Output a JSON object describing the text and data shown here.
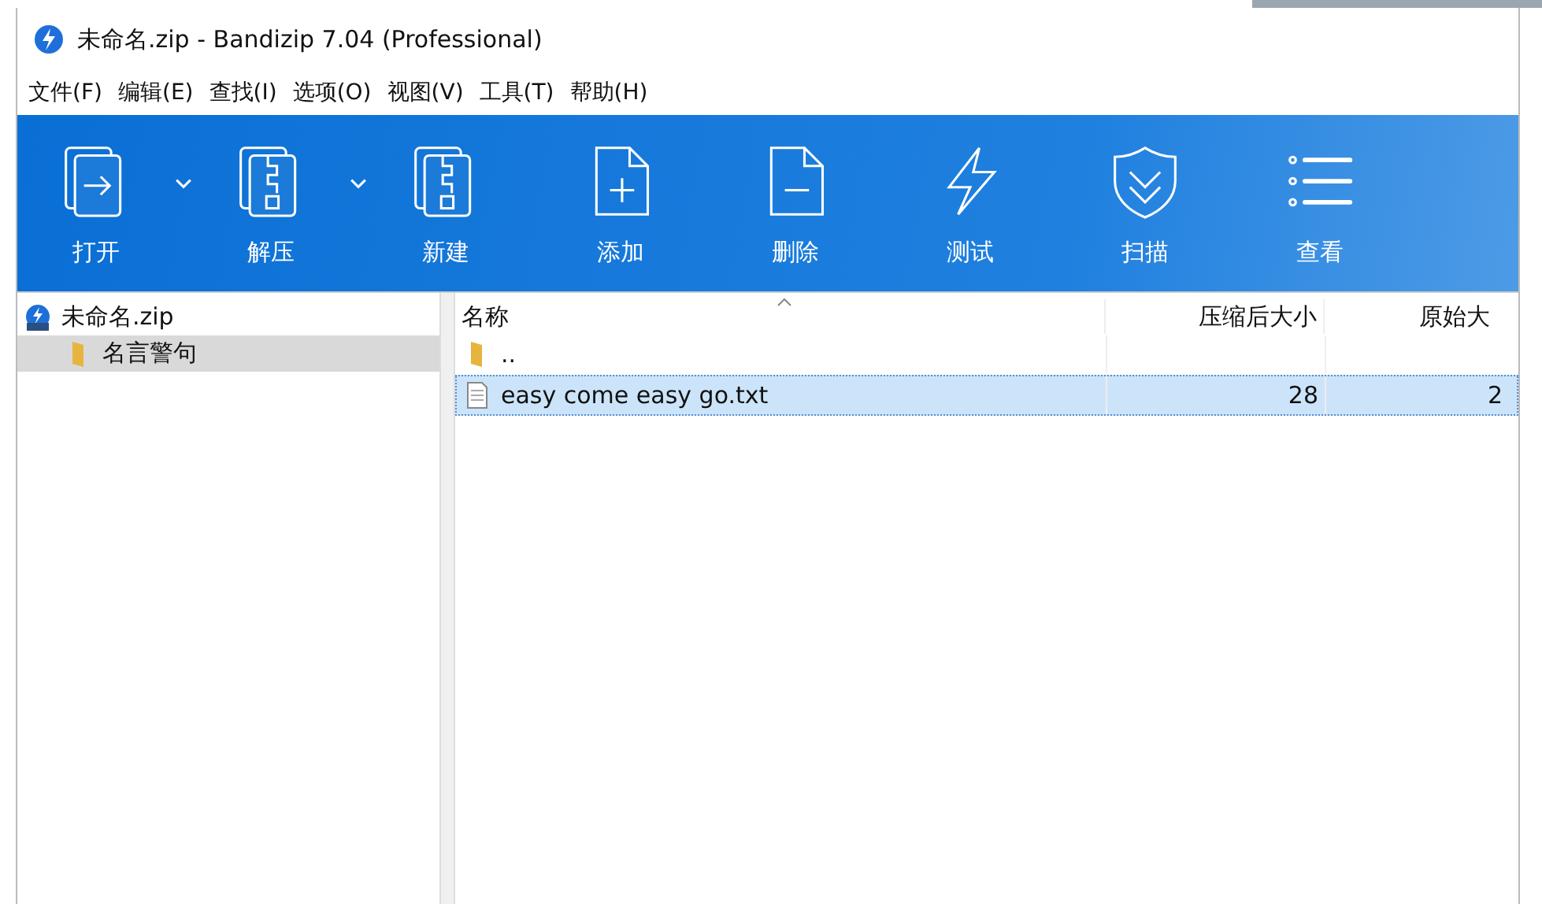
{
  "window": {
    "title": "未命名.zip - Bandizip 7.04 (Professional)"
  },
  "menu": [
    "文件(F)",
    "编辑(E)",
    "查找(I)",
    "选项(O)",
    "视图(V)",
    "工具(T)",
    "帮助(H)"
  ],
  "toolbar": [
    {
      "label": "打开",
      "kind": "open",
      "dropdown": true
    },
    {
      "label": "解压",
      "kind": "extract",
      "dropdown": true
    },
    {
      "label": "新建",
      "kind": "new",
      "dropdown": false
    },
    {
      "label": "添加",
      "kind": "add",
      "dropdown": false
    },
    {
      "label": "删除",
      "kind": "delete",
      "dropdown": false
    },
    {
      "label": "测试",
      "kind": "test",
      "dropdown": false
    },
    {
      "label": "扫描",
      "kind": "scan",
      "dropdown": false
    },
    {
      "label": "查看",
      "kind": "view",
      "dropdown": false
    }
  ],
  "tree": {
    "items": [
      {
        "label": "未命名.zip",
        "kind": "archive",
        "selected": false,
        "children": [
          {
            "label": "名言警句",
            "kind": "folder",
            "selected": true
          }
        ]
      }
    ]
  },
  "table": {
    "columns": [
      "名称",
      "压缩后大小",
      "原始大"
    ],
    "rows": [
      {
        "kind": "folder",
        "name": "..",
        "selected": false
      },
      {
        "kind": "file",
        "name": "easy come easy go.txt",
        "compressed": "28",
        "original": "2",
        "selected": true
      }
    ]
  }
}
